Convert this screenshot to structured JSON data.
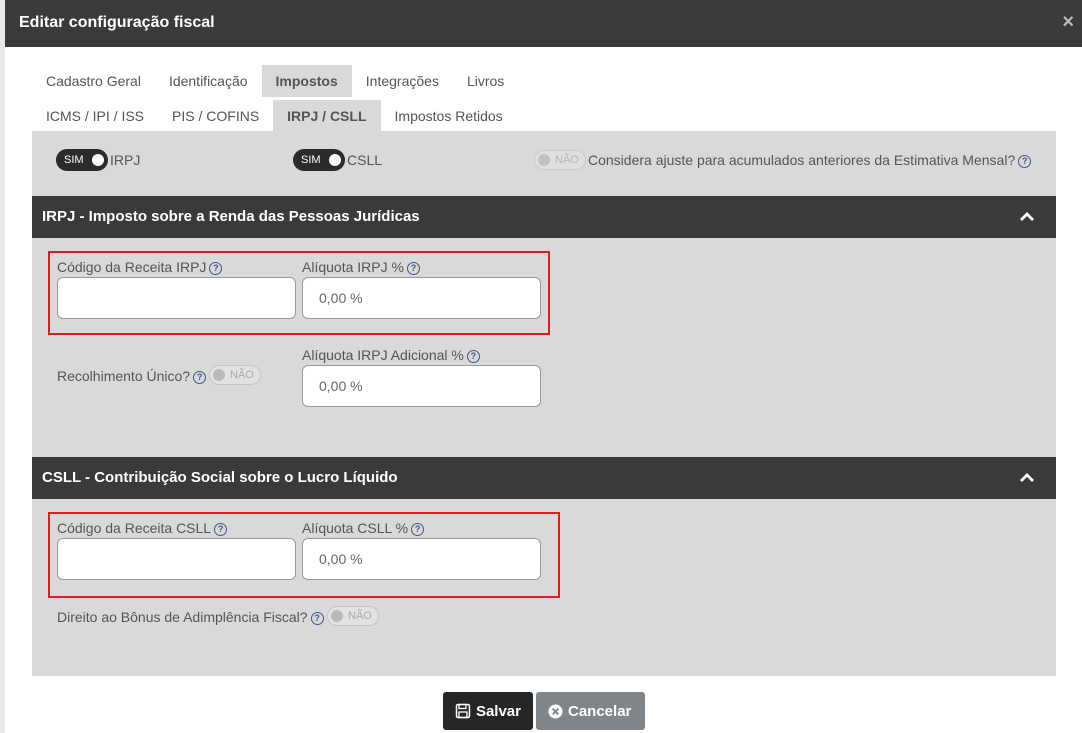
{
  "dialog": {
    "title": "Editar configuração fiscal",
    "close_icon": "×"
  },
  "tabs_main": [
    {
      "label": "Cadastro Geral"
    },
    {
      "label": "Identificação"
    },
    {
      "label": "Impostos"
    },
    {
      "label": "Integrações"
    },
    {
      "label": "Livros"
    }
  ],
  "tabs_sub": [
    {
      "label": "ICMS / IPI / ISS"
    },
    {
      "label": "PIS / COFINS"
    },
    {
      "label": "IRPJ / CSLL"
    },
    {
      "label": "Impostos Retidos"
    }
  ],
  "toggles_top": {
    "irpj": {
      "state": "SIM",
      "label": "IRPJ"
    },
    "csll": {
      "state": "SIM",
      "label": "CSLL"
    },
    "ajuste": {
      "state": "NÃO",
      "label": "Considera ajuste para acumulados anteriores da Estimativa Mensal?"
    }
  },
  "irpj_section": {
    "title": "IRPJ - Imposto sobre a Renda das Pessoas Jurídicas",
    "codigo_label": "Código da Receita IRPJ",
    "codigo_value": "",
    "aliquota_label": "Alíquota IRPJ %",
    "aliquota_value": "0,00 %",
    "recolhimento_label": "Recolhimento Único?",
    "recolhimento_state": "NÃO",
    "adicional_label": "Alíquota IRPJ Adicional %",
    "adicional_value": "0,00 %"
  },
  "csll_section": {
    "title": "CSLL - Contribuição Social sobre o Lucro Líquido",
    "codigo_label": "Código da Receita CSLL",
    "codigo_value": "",
    "aliquota_label": "Alíquota CSLL %",
    "aliquota_value": "0,00 %",
    "bonus_label": "Direito ao Bônus de Adimplência Fiscal?",
    "bonus_state": "NÃO"
  },
  "footer": {
    "save_label": "Salvar",
    "cancel_label": "Cancelar"
  },
  "help_glyph": "?",
  "colors": {
    "header": "#3a3a3a",
    "panel": "#d9d9d9",
    "highlight": "#e01b1b",
    "help": "#3b5a8a"
  }
}
